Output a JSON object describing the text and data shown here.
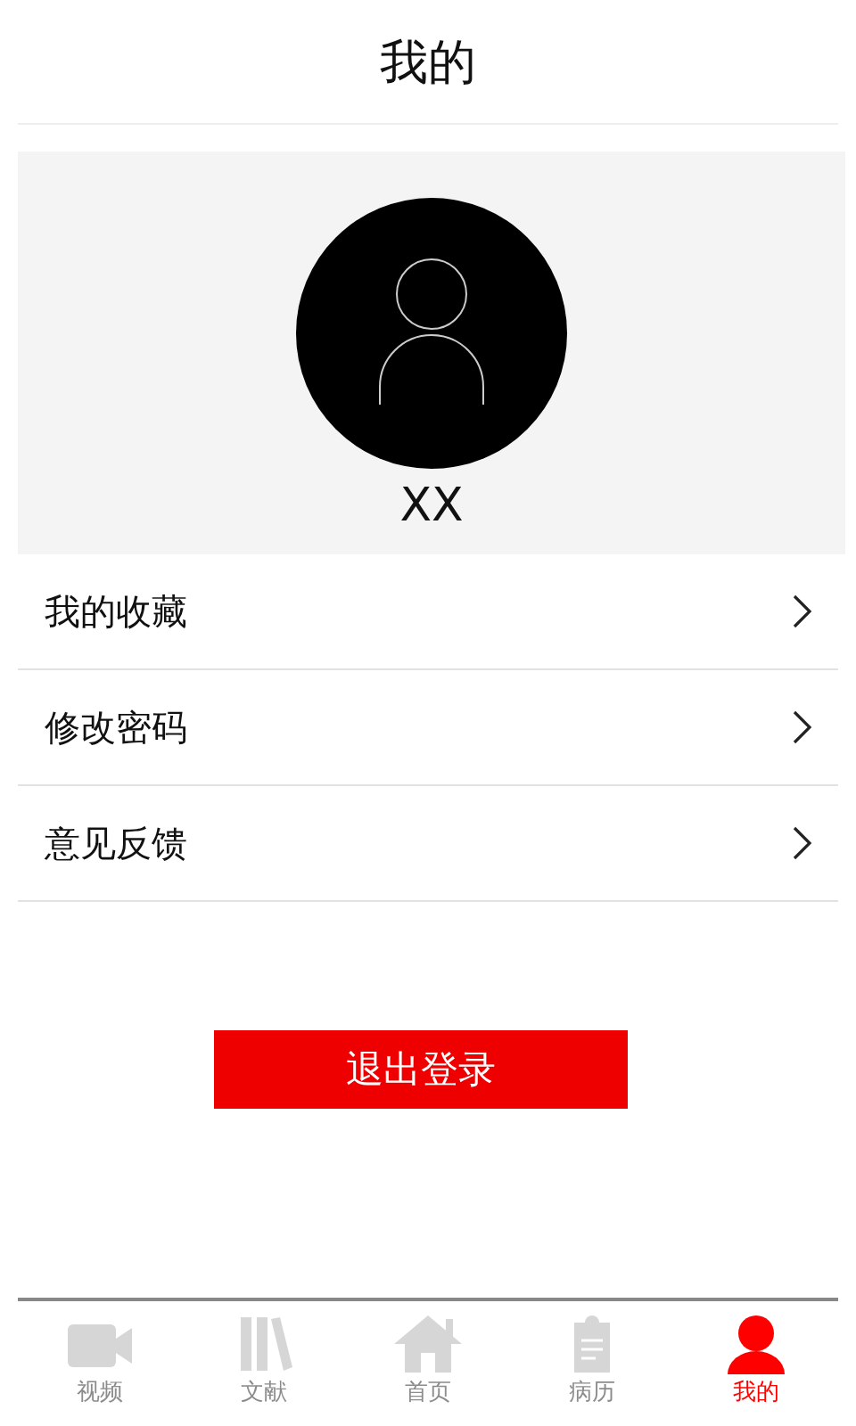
{
  "header": {
    "title": "我的"
  },
  "profile": {
    "name": "XX"
  },
  "menu": [
    {
      "label": "我的收藏"
    },
    {
      "label": "修改密码"
    },
    {
      "label": "意见反馈"
    }
  ],
  "logout": {
    "label": "退出登录"
  },
  "tabs": [
    {
      "label": "视频",
      "kind": "video",
      "selected": false
    },
    {
      "label": "文献",
      "kind": "books",
      "selected": false
    },
    {
      "label": "首页",
      "kind": "home",
      "selected": false
    },
    {
      "label": "病历",
      "kind": "record",
      "selected": false
    },
    {
      "label": "我的",
      "kind": "user",
      "selected": true
    }
  ]
}
